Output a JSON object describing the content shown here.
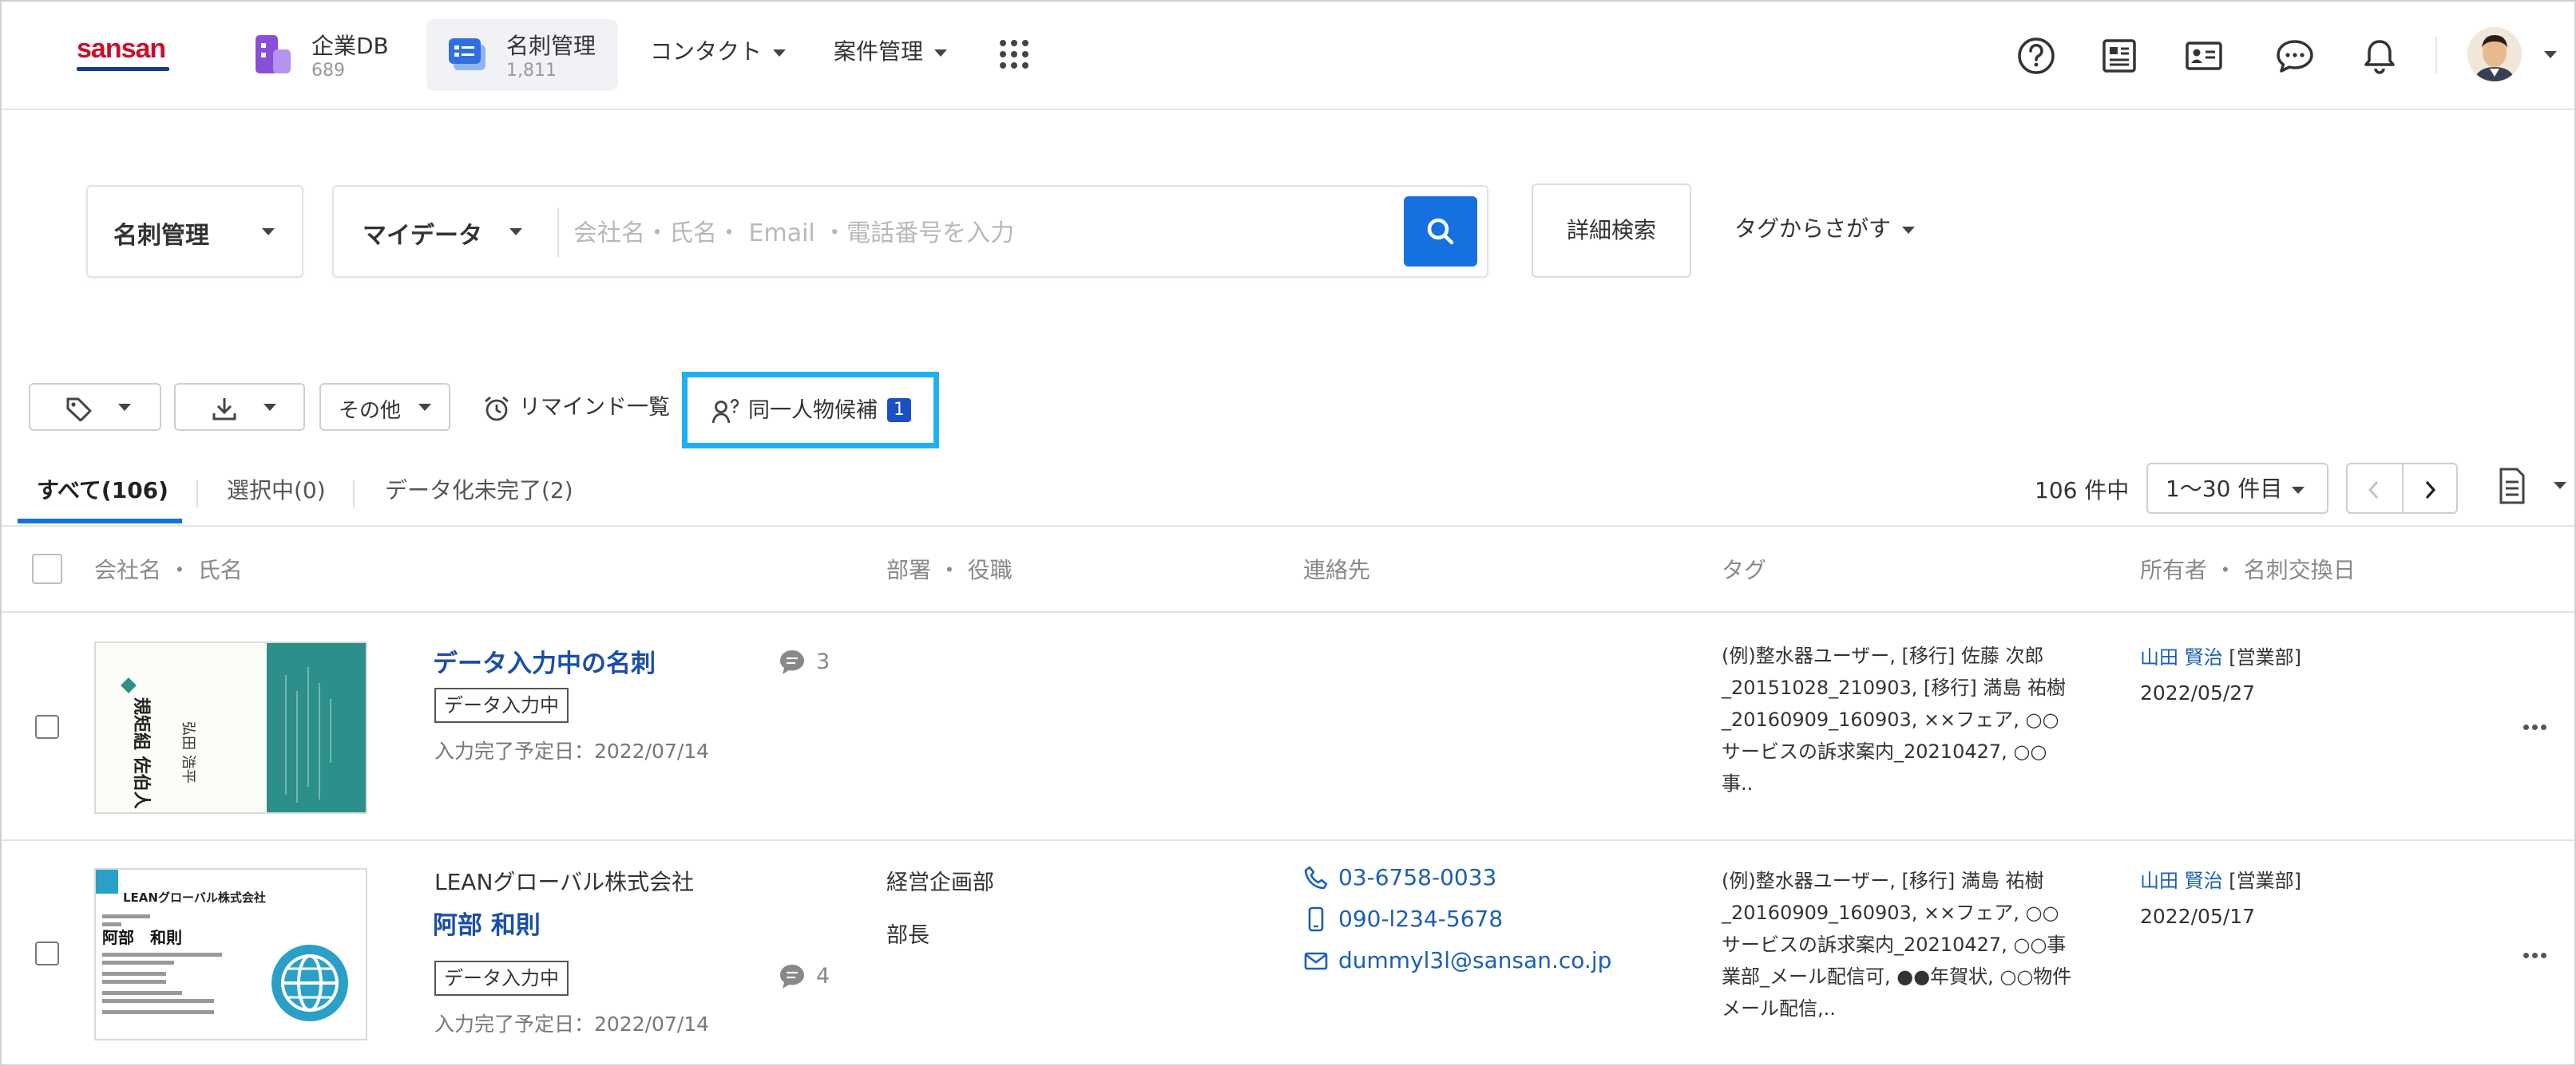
{
  "header": {
    "logo_text": "sansan",
    "apps": [
      {
        "title": "企業DB",
        "count": "689"
      },
      {
        "title": "名刺管理",
        "count": "1,811"
      }
    ],
    "menus": [
      "コンタクト",
      "案件管理"
    ],
    "icons": [
      "help-icon",
      "news-icon",
      "card-icon",
      "chat-icon",
      "bell-icon"
    ]
  },
  "search": {
    "module_select": "名刺管理",
    "scope_select": "マイデータ",
    "placeholder": "会社名・氏名・ Email ・電話番号を入力",
    "advanced_label": "詳細検索",
    "tag_search_label": "タグからさがす"
  },
  "toolbar": {
    "other_label": "その他",
    "remind_label": "リマインド一覧",
    "duplicate_label": "同一人物候補",
    "duplicate_count": "1"
  },
  "tabs": [
    {
      "label": "すべて(106)",
      "active": true
    },
    {
      "label": "選択中(0)",
      "active": false
    },
    {
      "label": "データ化未完了(2)",
      "active": false
    }
  ],
  "pagination": {
    "total_label": "106 件中",
    "range_label": "1〜30 件目"
  },
  "columns": [
    "会社名 ・ 氏名",
    "部署 ・ 役職",
    "連絡先",
    "タグ",
    "所有者 ・ 名刺交換日"
  ],
  "rows": [
    {
      "company": "",
      "name": "データ入力中の名刺",
      "status": "データ入力中",
      "due": "入力完了予定日：2022/07/14",
      "comments": "3",
      "department": "",
      "title": "",
      "phone": "",
      "mobile": "",
      "email": "",
      "tags": "(例)整水器ユーザー, [移行] 佐藤 次郎_20151028_210903, [移行] 満島 祐樹_20160909_160903, ××フェア, ○○サービスの訴求案内_20210427, ○○事..",
      "owner_name": "山田 賢治",
      "owner_dept": "[営業部]",
      "exchange_date": "2022/05/27",
      "card": {
        "lines": [
          "規矩組 佐伯人",
          "弘田 浩平"
        ]
      }
    },
    {
      "company": "LEANグローバル株式会社",
      "name": "阿部 和則",
      "status": "データ入力中",
      "due": "入力完了予定日：2022/07/14",
      "comments": "4",
      "department": "経営企画部",
      "title": "部長",
      "phone": "03-6758-0033",
      "mobile": "090-l234-5678",
      "email": "dummyl3l@sansan.co.jp",
      "tags": "(例)整水器ユーザー, [移行] 満島 祐樹_20160909_160903, ××フェア, ○○サービスの訴求案内_20210427, ○○事業部_メール配信可, ●●年賀状, ○○物件メール配信,..",
      "owner_name": "山田 賢治",
      "owner_dept": "[営業部]",
      "exchange_date": "2022/05/17",
      "card": {
        "lines": [
          "LEANグローバル株式会社",
          "阿部　和則"
        ]
      }
    }
  ],
  "colors": {
    "accent": "#1570e0",
    "link": "#1a5fb8",
    "highlight": "#1eb1f1",
    "logo_red": "#c8102e"
  }
}
